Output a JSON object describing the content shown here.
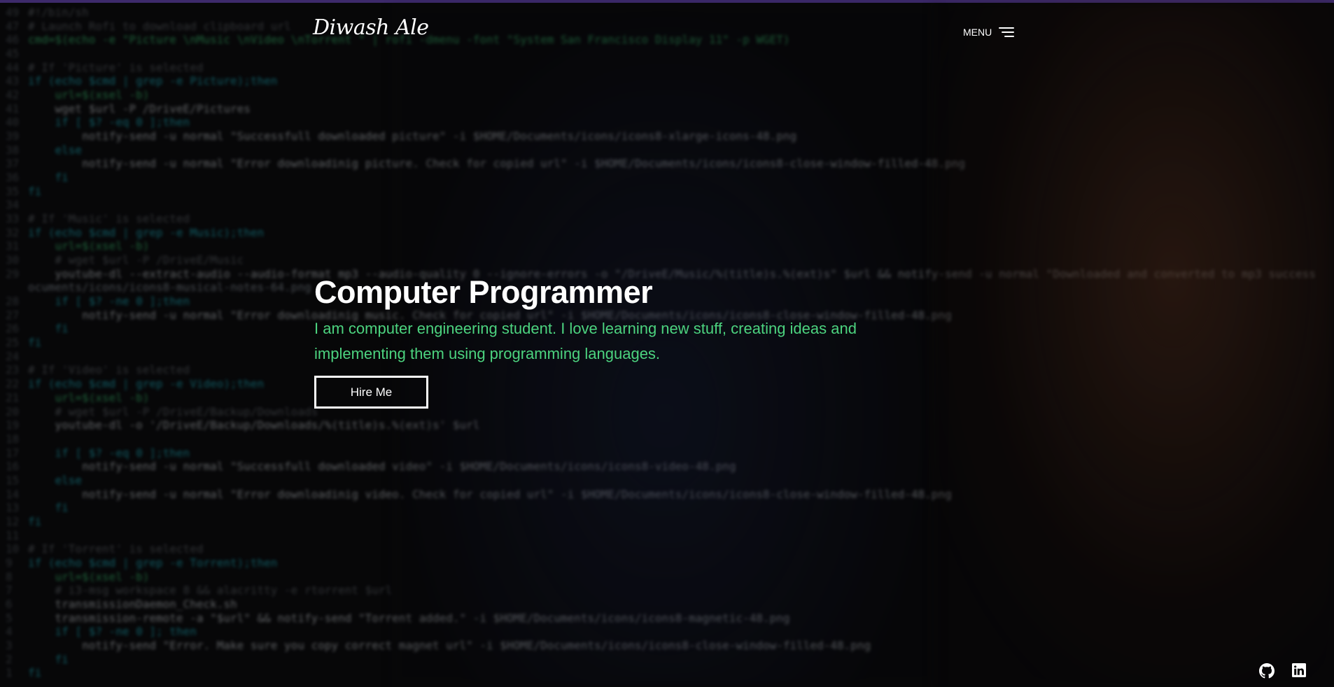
{
  "header": {
    "logo": "Diwash Ale",
    "menu_label": "MENU"
  },
  "hero": {
    "title": "Computer Programmer",
    "description": "I am computer engineering student. I love learning new stuff, creating ideas and implementing them using programming languages.",
    "button_label": "Hire Me"
  },
  "social": {
    "icons": [
      "github-icon",
      "linkedin-icon"
    ]
  },
  "background_code": [
    {
      "n": "49",
      "t": "#!/bin/sh"
    },
    {
      "n": "47",
      "t": "# Launch Rofi to download clipboard url"
    },
    {
      "n": "46",
      "t": "cmd=$(echo -e \"Picture \\nMusic \\nVideo \\nTorrent \" | rofi -dmenu -font \"System San Francisco Display 11\" -p WGET)"
    },
    {
      "n": "45",
      "t": ""
    },
    {
      "n": "44",
      "t": "# If 'Picture' is selected"
    },
    {
      "n": "43",
      "t": "if (echo $cmd | grep -e Picture);then"
    },
    {
      "n": "42",
      "t": "    url=$(xsel -b)"
    },
    {
      "n": "41",
      "t": "    wget $url -P /DriveE/Pictures"
    },
    {
      "n": "40",
      "t": "    if [ $? -eq 0 ];then"
    },
    {
      "n": "39",
      "t": "        notify-send -u normal \"Successfull downloaded picture\" -i $HOME/Documents/icons/icons8-xlarge-icons-48.png"
    },
    {
      "n": "38",
      "t": "    else"
    },
    {
      "n": "37",
      "t": "        notify-send -u normal \"Error downloadinig picture. Check for copied url\" -i $HOME/Documents/icons/icons8-close-window-filled-48.png"
    },
    {
      "n": "36",
      "t": "    fi"
    },
    {
      "n": "35",
      "t": "fi"
    },
    {
      "n": "34",
      "t": ""
    },
    {
      "n": "33",
      "t": "# If 'Music' is selected"
    },
    {
      "n": "32",
      "t": "if (echo $cmd | grep -e Music);then"
    },
    {
      "n": "31",
      "t": "    url=$(xsel -b)"
    },
    {
      "n": "30",
      "t": "    # wget $url -P /DriveE/Music"
    },
    {
      "n": "29",
      "t": "    youtube-dl --extract-audio --audio-format mp3 --audio-quality 0 --ignore-errors -o \"/DriveE/Music/%(title)s.%(ext)s\" $url && notify-send -u normal \"Downloaded and converted to mp3 success"
    },
    {
      "n": "",
      "t": "ocuments/icons/icons8-musical-notes-64.png"
    },
    {
      "n": "28",
      "t": "    if [ $? -ne 0 ];then"
    },
    {
      "n": "27",
      "t": "        notify-send -u normal \"Error downloadinig music. Check for copied url\" -i $HOME/Documents/icons/icons8-close-window-filled-48.png"
    },
    {
      "n": "26",
      "t": "    fi"
    },
    {
      "n": "25",
      "t": "fi"
    },
    {
      "n": "24",
      "t": ""
    },
    {
      "n": "23",
      "t": "# If 'Video' is selected"
    },
    {
      "n": "22",
      "t": "if (echo $cmd | grep -e Video);then"
    },
    {
      "n": "21",
      "t": "    url=$(xsel -b)"
    },
    {
      "n": "20",
      "t": "    # wget $url -P /DriveE/Backup/Downloads"
    },
    {
      "n": "19",
      "t": "    youtube-dl -o '/DriveE/Backup/Downloads/%(title)s.%(ext)s' $url"
    },
    {
      "n": "18",
      "t": ""
    },
    {
      "n": "17",
      "t": "    if [ $? -eq 0 ];then"
    },
    {
      "n": "16",
      "t": "        notify-send -u normal \"Successfull downloaded video\" -i $HOME/Documents/icons/icons8-video-48.png"
    },
    {
      "n": "15",
      "t": "    else"
    },
    {
      "n": "14",
      "t": "        notify-send -u normal \"Error downloadinig video. Check for copied url\" -i $HOME/Documents/icons/icons8-close-window-filled-48.png"
    },
    {
      "n": "13",
      "t": "    fi"
    },
    {
      "n": "12",
      "t": "fi"
    },
    {
      "n": "11",
      "t": ""
    },
    {
      "n": "10",
      "t": "# If 'Torrent' is selected"
    },
    {
      "n": "9",
      "t": "if (echo $cmd | grep -e Torrent);then"
    },
    {
      "n": "8",
      "t": "    url=$(xsel -b)"
    },
    {
      "n": "7",
      "t": "    # i3-msg workspace 8 && alacritty -e rtorrent $url"
    },
    {
      "n": "6",
      "t": "    transmissionDaemon_Check.sh"
    },
    {
      "n": "5",
      "t": "    transmission-remote -a \"$url\" && notify-send \"Torrent added.\" -i $HOME/Documents/icons/icons8-magnetic-48.png"
    },
    {
      "n": "4",
      "t": "    if [ $? -ne 0 ]; then"
    },
    {
      "n": "3",
      "t": "        notify-send \"Error. Make sure you copy correct magnet url\" -i $HOME/Documents/icons/icons8-close-window-filled-48.png"
    },
    {
      "n": "2",
      "t": "    fi"
    },
    {
      "n": "1",
      "t": "fi"
    }
  ]
}
